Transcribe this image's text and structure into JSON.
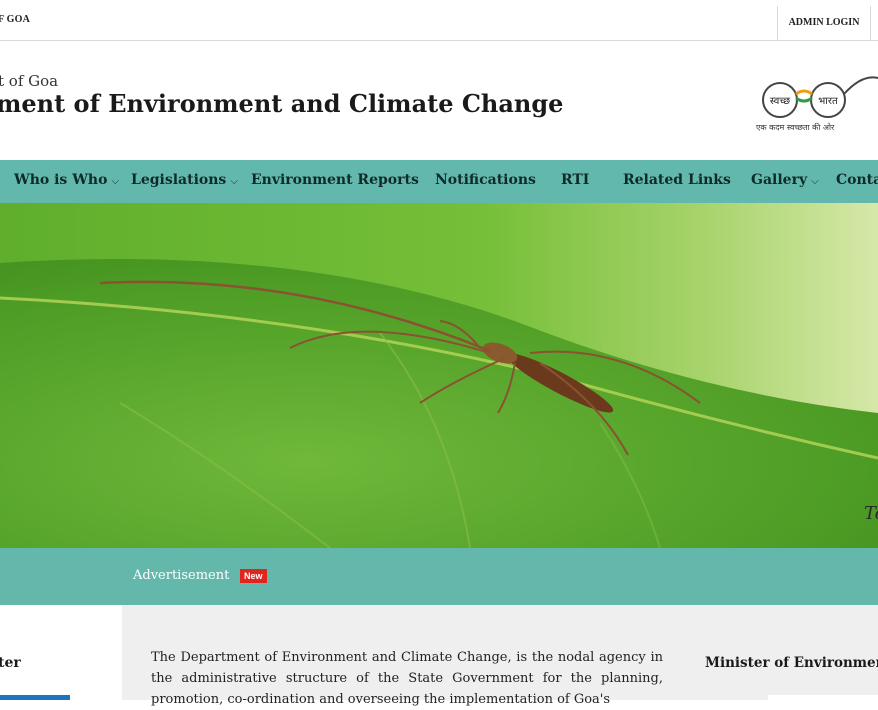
{
  "topbar": {
    "gov_fragment": "F GOA",
    "admin_login": "ADMIN LOGIN"
  },
  "header": {
    "subtitle_fragment": "t of Goa",
    "title_fragment": "ment of Environment and Climate Change",
    "logo": {
      "left_word": "स्वच्छ",
      "right_word": "भारत",
      "tagline": "एक कदम स्वच्छता की ओर"
    }
  },
  "nav": {
    "items": [
      {
        "label": "Who is Who",
        "has_dropdown": true
      },
      {
        "label": "Legislations",
        "has_dropdown": true
      },
      {
        "label": "Environment Reports",
        "has_dropdown": false
      },
      {
        "label": "Notifications",
        "has_dropdown": false
      },
      {
        "label": "RTI",
        "has_dropdown": false
      },
      {
        "label": "Related Links",
        "has_dropdown": false
      },
      {
        "label": "Gallery",
        "has_dropdown": true
      },
      {
        "label": "Contac",
        "has_dropdown": false
      }
    ],
    "chevron": "⌵"
  },
  "hero": {
    "caption_fragment": "Te",
    "icon": "spider-on-leaf-photo"
  },
  "advertisement": {
    "label": "Advertisement",
    "badge": "New"
  },
  "sidebar_left": {
    "title_fragment": "ter"
  },
  "main": {
    "intro_text": "The Department of Environment and Climate Change, is the nodal agency in the administrative structure of the State Government for the planning, promotion, co-ordination and overseeing the implementation of Goa's"
  },
  "sidebar_right": {
    "title_fragment": "Minister of Environmen"
  },
  "colors": {
    "nav_bg": "#62b8ac",
    "ad_band_bg": "#63b7ab",
    "badge_red": "#e1241d",
    "content_bg": "#efefef",
    "accent_blue": "#1e73be"
  }
}
